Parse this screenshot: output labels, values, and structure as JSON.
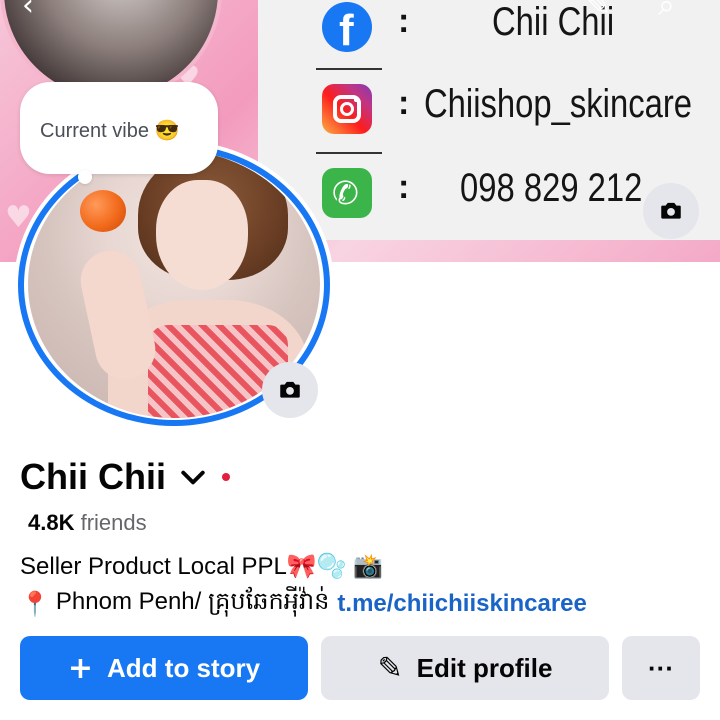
{
  "cover": {
    "contacts": [
      {
        "icon": "facebook-icon",
        "separator": ":",
        "value": "Chii Chii"
      },
      {
        "icon": "instagram-icon",
        "separator": ":",
        "value": "Chiishop_skincare"
      },
      {
        "icon": "phone-icon",
        "separator": ":",
        "value": "098 829 212"
      }
    ]
  },
  "note": {
    "text": "Current vibe 😎"
  },
  "profile": {
    "name": "Chii Chii",
    "friends_count": "4.8K",
    "friends_label": "friends",
    "bio_line1": "Seller Product Local PPL🎀🫧 📸",
    "location": "Phnom Penh/ គ្រុបឆែកអុីវ៉ាន់",
    "link": "t.me/chiichiiskincaree"
  },
  "actions": {
    "add_story_label": "Add to story",
    "edit_profile_label": "Edit profile",
    "more_label": "···"
  },
  "colors": {
    "accent": "#1877f2",
    "secondary_button": "#e4e6eb",
    "link": "#1a64c8",
    "online_dot": "#e41e3f"
  }
}
